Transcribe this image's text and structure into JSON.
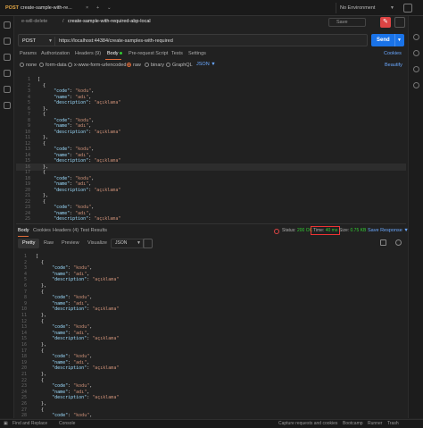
{
  "tabbar": {
    "tab1": {
      "method": "POST",
      "label": "create-sample-with-re..."
    },
    "tab_plus": "+",
    "tab_more": "⌄",
    "env": "No Environment"
  },
  "crumbs": {
    "collection": "e-will-delete",
    "sep": "/",
    "request": "create-sample-with-required-abp-local"
  },
  "toolbar": {
    "save_label": "Save"
  },
  "request": {
    "method": "POST",
    "url": "https://localhost:44384/create-samples-with-required",
    "send_label": "Send"
  },
  "req_tabs": [
    "Params",
    "Authorization",
    "Headers (9)",
    "Body",
    "Pre-request Script",
    "Tests",
    "Settings"
  ],
  "cookies_label": "Cookies",
  "body_types": [
    "none",
    "form-data",
    "x-www-form-urlencoded",
    "raw",
    "binary",
    "GraphQL"
  ],
  "json_label": "JSON",
  "beautify_label": "Beautify",
  "req_lines": [
    {
      "n": "1",
      "t": "["
    },
    {
      "n": "2",
      "t": "  {"
    },
    {
      "n": "3",
      "k": "\"code\"",
      "v": "\"kodu\""
    },
    {
      "n": "4",
      "k": "\"name\"",
      "v": "\"adı\""
    },
    {
      "n": "5",
      "k": "\"description\"",
      "v": "\"açıklama\"",
      "last": true
    },
    {
      "n": "6",
      "t": "  },"
    },
    {
      "n": "7",
      "t": "  {"
    },
    {
      "n": "8",
      "k": "\"code\"",
      "v": "\"kodu\""
    },
    {
      "n": "9",
      "k": "\"name\"",
      "v": "\"adı\""
    },
    {
      "n": "10",
      "k": "\"description\"",
      "v": "\"açıklama\"",
      "last": true
    },
    {
      "n": "11",
      "t": "  },"
    },
    {
      "n": "12",
      "t": "  {"
    },
    {
      "n": "13",
      "k": "\"code\"",
      "v": "\"kodu\""
    },
    {
      "n": "14",
      "k": "\"name\"",
      "v": "\"adı\""
    },
    {
      "n": "15",
      "k": "\"description\"",
      "v": "\"açıklama\"",
      "last": true
    },
    {
      "n": "16",
      "t": "  },"
    },
    {
      "n": "17",
      "t": "  {"
    },
    {
      "n": "18",
      "k": "\"code\"",
      "v": "\"kodu\""
    },
    {
      "n": "19",
      "k": "\"name\"",
      "v": "\"adı\""
    },
    {
      "n": "20",
      "k": "\"description\"",
      "v": "\"açıklama\"",
      "last": true
    },
    {
      "n": "21",
      "t": "  },"
    },
    {
      "n": "22",
      "t": "  {"
    },
    {
      "n": "23",
      "k": "\"code\"",
      "v": "\"kodu\""
    },
    {
      "n": "24",
      "k": "\"name\"",
      "v": "\"adı\""
    },
    {
      "n": "25",
      "k": "\"description\"",
      "v": "\"açıklama\"",
      "last": true
    }
  ],
  "resp_tabs": [
    "Body",
    "Cookies",
    "Headers (4)",
    "Test Results"
  ],
  "status": {
    "label": "Status:",
    "value": "200 OK",
    "time_label": "Time:",
    "time_value": "40 ms",
    "size_label": "Size:",
    "size_value": "0.75 KB",
    "save_label": "Save Response"
  },
  "view_tabs": [
    "Pretty",
    "Raw",
    "Preview",
    "Visualize"
  ],
  "view_json": "JSON",
  "resp_lines": [
    {
      "n": "1",
      "t": "["
    },
    {
      "n": "2",
      "t": "  {"
    },
    {
      "n": "3",
      "k": "\"code\"",
      "v": "\"kodu\""
    },
    {
      "n": "4",
      "k": "\"name\"",
      "v": "\"adı\""
    },
    {
      "n": "5",
      "k": "\"description\"",
      "v": "\"açıklama\"",
      "last": true
    },
    {
      "n": "6",
      "t": "  },"
    },
    {
      "n": "7",
      "t": "  {"
    },
    {
      "n": "8",
      "k": "\"code\"",
      "v": "\"kodu\""
    },
    {
      "n": "9",
      "k": "\"name\"",
      "v": "\"adı\""
    },
    {
      "n": "10",
      "k": "\"description\"",
      "v": "\"açıklama\"",
      "last": true
    },
    {
      "n": "11",
      "t": "  },"
    },
    {
      "n": "12",
      "t": "  {"
    },
    {
      "n": "13",
      "k": "\"code\"",
      "v": "\"kodu\""
    },
    {
      "n": "14",
      "k": "\"name\"",
      "v": "\"adı\""
    },
    {
      "n": "15",
      "k": "\"description\"",
      "v": "\"açıklama\"",
      "last": true
    },
    {
      "n": "16",
      "t": "  },"
    },
    {
      "n": "17",
      "t": "  {"
    },
    {
      "n": "18",
      "k": "\"code\"",
      "v": "\"kodu\""
    },
    {
      "n": "19",
      "k": "\"name\"",
      "v": "\"adı\""
    },
    {
      "n": "20",
      "k": "\"description\"",
      "v": "\"açıklama\"",
      "last": true
    },
    {
      "n": "21",
      "t": "  },"
    },
    {
      "n": "22",
      "t": "  {"
    },
    {
      "n": "23",
      "k": "\"code\"",
      "v": "\"kodu\""
    },
    {
      "n": "24",
      "k": "\"name\"",
      "v": "\"adı\""
    },
    {
      "n": "25",
      "k": "\"description\"",
      "v": "\"açıklama\"",
      "last": true
    },
    {
      "n": "26",
      "t": "  },"
    },
    {
      "n": "27",
      "t": "  {"
    },
    {
      "n": "28",
      "k": "\"code\"",
      "v": "\"kodu\""
    }
  ],
  "statusbar": {
    "find_replace": "Find and Replace",
    "console": "Console",
    "capture": "Capture requests and cookies",
    "bootcamp": "Bootcamp",
    "runner": "Runner",
    "trash": "Trash"
  },
  "colors": {
    "accent": "#e06c3a",
    "send": "#1a73e8",
    "ok": "#33cc33",
    "highlight_box": "#ee3333"
  }
}
